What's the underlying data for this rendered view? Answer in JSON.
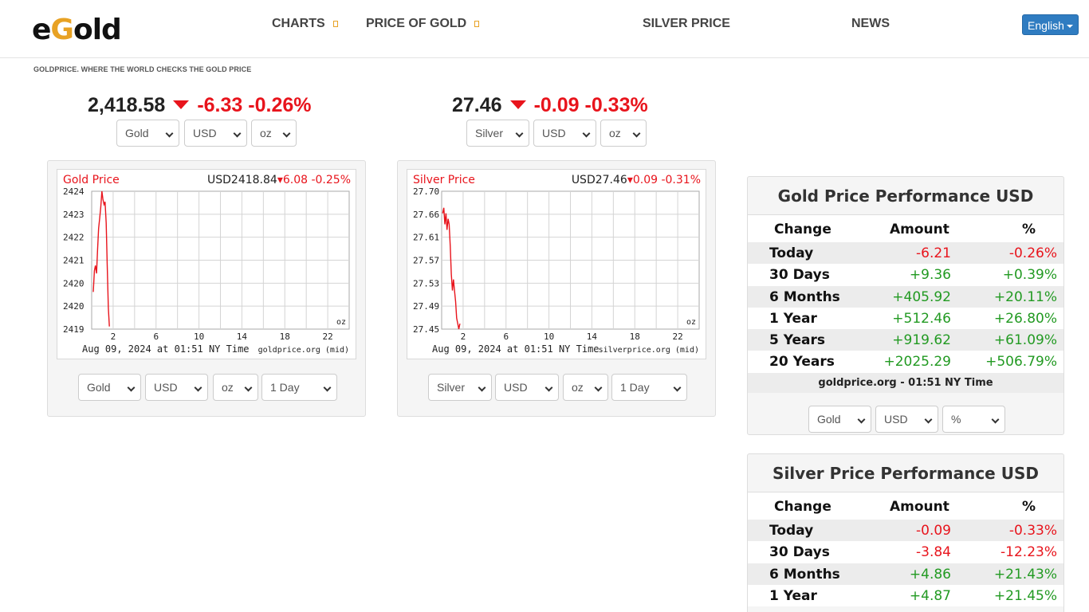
{
  "header": {
    "logo": {
      "e": "e",
      "g": "G",
      "rest": "old"
    },
    "nav": {
      "charts": "CHARTS",
      "price_of_gold": "PRICE OF GOLD",
      "silver_price": "SILVER PRICE",
      "news": "NEWS"
    },
    "language": "English"
  },
  "tagline": "GOLDPRICE. WHERE THE WORLD CHECKS THE GOLD PRICE",
  "gold_headline": {
    "price": "2,418.58",
    "change": "-6.33",
    "percent": "-0.26%"
  },
  "silver_headline": {
    "price": "27.46",
    "change": "-0.09",
    "percent": "-0.33%"
  },
  "gold_selects": {
    "metal": "Gold",
    "currency": "USD",
    "unit": "oz"
  },
  "silver_selects": {
    "metal": "Silver",
    "currency": "USD",
    "unit": "oz"
  },
  "gold_chart_controls": {
    "metal": "Gold",
    "currency": "USD",
    "unit": "oz",
    "range": "1 Day"
  },
  "silver_chart_controls": {
    "metal": "Silver",
    "currency": "USD",
    "unit": "oz",
    "range": "1 Day"
  },
  "colors": {
    "negative": "#e8141c",
    "positive": "#229a22",
    "accent": "#e8a224",
    "button": "#2f7cc1"
  },
  "chart_data": [
    {
      "type": "line",
      "title": "Gold Price",
      "header_value": "USD2418.84",
      "header_change": "6.08",
      "header_percent": "-0.25%",
      "unit_label": "oz",
      "footer": "Aug 09, 2024 at 01:51 NY Time",
      "source": "goldprice.org (mid)",
      "x_ticks": [
        "2",
        "6",
        "10",
        "14",
        "18",
        "22"
      ],
      "y_ticks": [
        "2424",
        "2423",
        "2422",
        "2421",
        "2420",
        "2420",
        "2419"
      ],
      "ylim": [
        2418.8,
        2424
      ],
      "xlim": [
        0,
        24
      ],
      "x": [
        0.15,
        0.25,
        0.35,
        0.45,
        0.55,
        0.65,
        0.75,
        0.85,
        0.95,
        1.05,
        1.15,
        1.25,
        1.35,
        1.45,
        1.55,
        1.65
      ],
      "y": [
        2420.2,
        2421.0,
        2421.2,
        2420.9,
        2421.8,
        2422.6,
        2423.0,
        2423.4,
        2424.0,
        2423.7,
        2423.5,
        2423.6,
        2422.8,
        2421.2,
        2419.6,
        2418.9
      ]
    },
    {
      "type": "line",
      "title": "Silver Price",
      "header_value": "USD27.46",
      "header_change": "0.09",
      "header_percent": "-0.31%",
      "unit_label": "oz",
      "footer": "Aug 09, 2024 at 01:51 NY Time",
      "source": "silverprice.org (mid)",
      "x_ticks": [
        "2",
        "6",
        "10",
        "14",
        "18",
        "22"
      ],
      "y_ticks": [
        "27.70",
        "27.66",
        "27.61",
        "27.57",
        "27.53",
        "27.49",
        "27.45"
      ],
      "ylim": [
        27.45,
        27.7
      ],
      "xlim": [
        0,
        24
      ],
      "x": [
        0.1,
        0.2,
        0.3,
        0.4,
        0.5,
        0.6,
        0.7,
        0.8,
        0.9,
        1.0,
        1.1,
        1.2,
        1.3,
        1.4,
        1.5,
        1.6,
        1.7
      ],
      "y": [
        27.66,
        27.67,
        27.64,
        27.66,
        27.63,
        27.65,
        27.64,
        27.6,
        27.55,
        27.52,
        27.54,
        27.52,
        27.5,
        27.47,
        27.46,
        27.45,
        27.46
      ]
    }
  ],
  "gold_performance": {
    "title": "Gold Price Performance USD",
    "headers": [
      "Change",
      "Amount",
      "%"
    ],
    "rows": [
      {
        "label": "Today",
        "amount": "-6.21",
        "percent": "-0.26%",
        "sign": "neg"
      },
      {
        "label": "30 Days",
        "amount": "+9.36",
        "percent": "+0.39%",
        "sign": "pos"
      },
      {
        "label": "6 Months",
        "amount": "+405.92",
        "percent": "+20.11%",
        "sign": "pos"
      },
      {
        "label": "1 Year",
        "amount": "+512.46",
        "percent": "+26.80%",
        "sign": "pos"
      },
      {
        "label": "5 Years",
        "amount": "+919.62",
        "percent": "+61.09%",
        "sign": "pos"
      },
      {
        "label": "20 Years",
        "amount": "+2025.29",
        "percent": "+506.79%",
        "sign": "pos"
      }
    ],
    "footer": "goldprice.org - 01:51 NY Time",
    "selects": {
      "metal": "Gold",
      "currency": "USD",
      "unit": "%"
    }
  },
  "silver_performance": {
    "title": "Silver Price Performance USD",
    "headers": [
      "Change",
      "Amount",
      "%"
    ],
    "rows": [
      {
        "label": "Today",
        "amount": "-0.09",
        "percent": "-0.33%",
        "sign": "neg"
      },
      {
        "label": "30 Days",
        "amount": "-3.84",
        "percent": "-12.23%",
        "sign": "neg"
      },
      {
        "label": "6 Months",
        "amount": "+4.86",
        "percent": "+21.43%",
        "sign": "pos"
      },
      {
        "label": "1 Year",
        "amount": "+4.87",
        "percent": "+21.45%",
        "sign": "pos"
      }
    ]
  }
}
